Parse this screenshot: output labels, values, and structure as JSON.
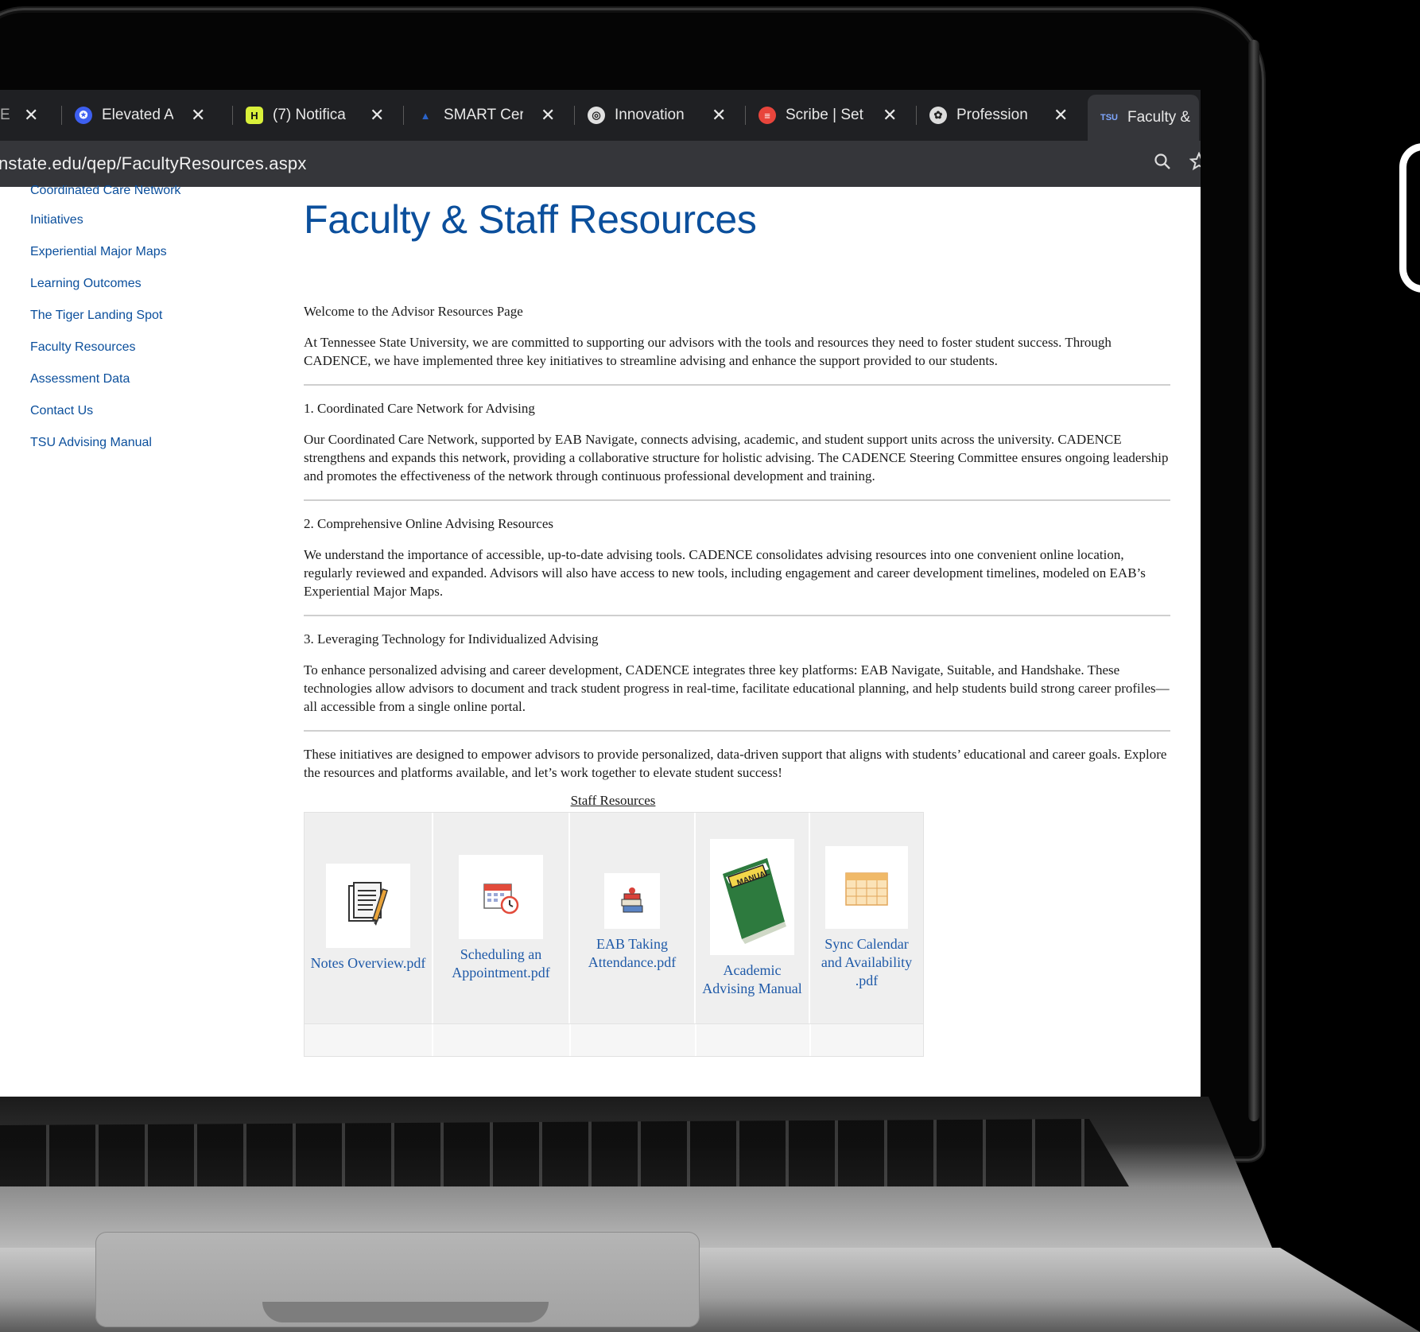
{
  "browser": {
    "tabs": [
      {
        "title": "E F",
        "favicon": "generic",
        "color": "#555"
      },
      {
        "title": "Elevated Ac",
        "favicon": "badge-icon",
        "color": "#4a6cf7"
      },
      {
        "title": "(7) Notifica",
        "favicon": "h-logo-icon",
        "color": "#d9f03a"
      },
      {
        "title": "SMART Cer",
        "favicon": "tsu-logo-icon",
        "color": "#1d4fa8"
      },
      {
        "title": "Innovation",
        "favicon": "globe-icon",
        "color": "#cfcfcf"
      },
      {
        "title": "Scribe | Set",
        "favicon": "scribe-icon",
        "color": "#e8453c"
      },
      {
        "title": "Profession",
        "favicon": "openai-icon",
        "color": "#cfcfcf"
      },
      {
        "title": "Faculty &",
        "favicon": "tsu-logo-icon",
        "color": "#1d4fa8"
      }
    ],
    "close_glyph": "✕",
    "url": "nstate.edu/qep/FacultyResources.aspx"
  },
  "sidebar": {
    "items": [
      {
        "label": "Coordinated Care Network"
      },
      {
        "label": "Initiatives"
      },
      {
        "label": "Experiential Major Maps"
      },
      {
        "label": "Learning Outcomes"
      },
      {
        "label": "The Tiger Landing Spot"
      },
      {
        "label": "Faculty Resources"
      },
      {
        "label": "Assessment Data"
      },
      {
        "label": "Contact Us"
      },
      {
        "label": "TSU Advising Manual"
      }
    ]
  },
  "main": {
    "title": "Faculty & Staff Resources",
    "welcome": "Welcome to the Advisor Resources Page",
    "intro": "At Tennessee State University, we are committed to supporting our advisors with the tools and resources they need to foster student success. Through CADENCE, we have implemented three key initiatives to streamline advising and enhance the support provided to our students.",
    "sections": [
      {
        "heading": "1. Coordinated Care Network for Advising",
        "body": "Our Coordinated Care Network, supported by EAB Navigate, connects advising, academic, and student support units across the university. CADENCE strengthens and expands this network, providing a collaborative structure for holistic advising. The CADENCE Steering Committee ensures ongoing leadership and promotes the effectiveness of the network through continuous professional development and training."
      },
      {
        "heading": "2. Comprehensive Online Advising Resources",
        "body": "We understand the importance of accessible, up-to-date advising tools. CADENCE consolidates advising resources into one convenient online location, regularly reviewed and expanded. Advisors will also have access to new tools, including engagement and career development timelines, modeled on EAB’s Experiential Major Maps."
      },
      {
        "heading": "3. Leveraging Technology for Individualized Advising",
        "body": "To enhance personalized advising and career development, CADENCE integrates three key platforms: EAB Navigate, Suitable, and Handshake. These technologies allow advisors to document and track student progress in real-time, facilitate educational planning, and help students build strong career profiles—all accessible from a single online portal."
      }
    ],
    "closing": "These initiatives are designed to empower advisors to provide personalized, data-driven support that aligns with students’ educational and career goals. Explore the resources and platforms available, and let’s work together to elevate student success!",
    "staff_resources_title": "Staff Resources",
    "resources": [
      {
        "label": "Notes Overview.pdf",
        "icon": "notes-document-icon"
      },
      {
        "label": "Scheduling an Appointment.pdf",
        "icon": "calendar-clock-icon"
      },
      {
        "label": "EAB Taking Attendance.pdf",
        "icon": "books-icon"
      },
      {
        "label": "Academic Advising Manual",
        "icon": "manual-book-icon"
      },
      {
        "label": "Sync Calendar and Availability .pdf",
        "icon": "calendar-grid-icon"
      }
    ]
  }
}
